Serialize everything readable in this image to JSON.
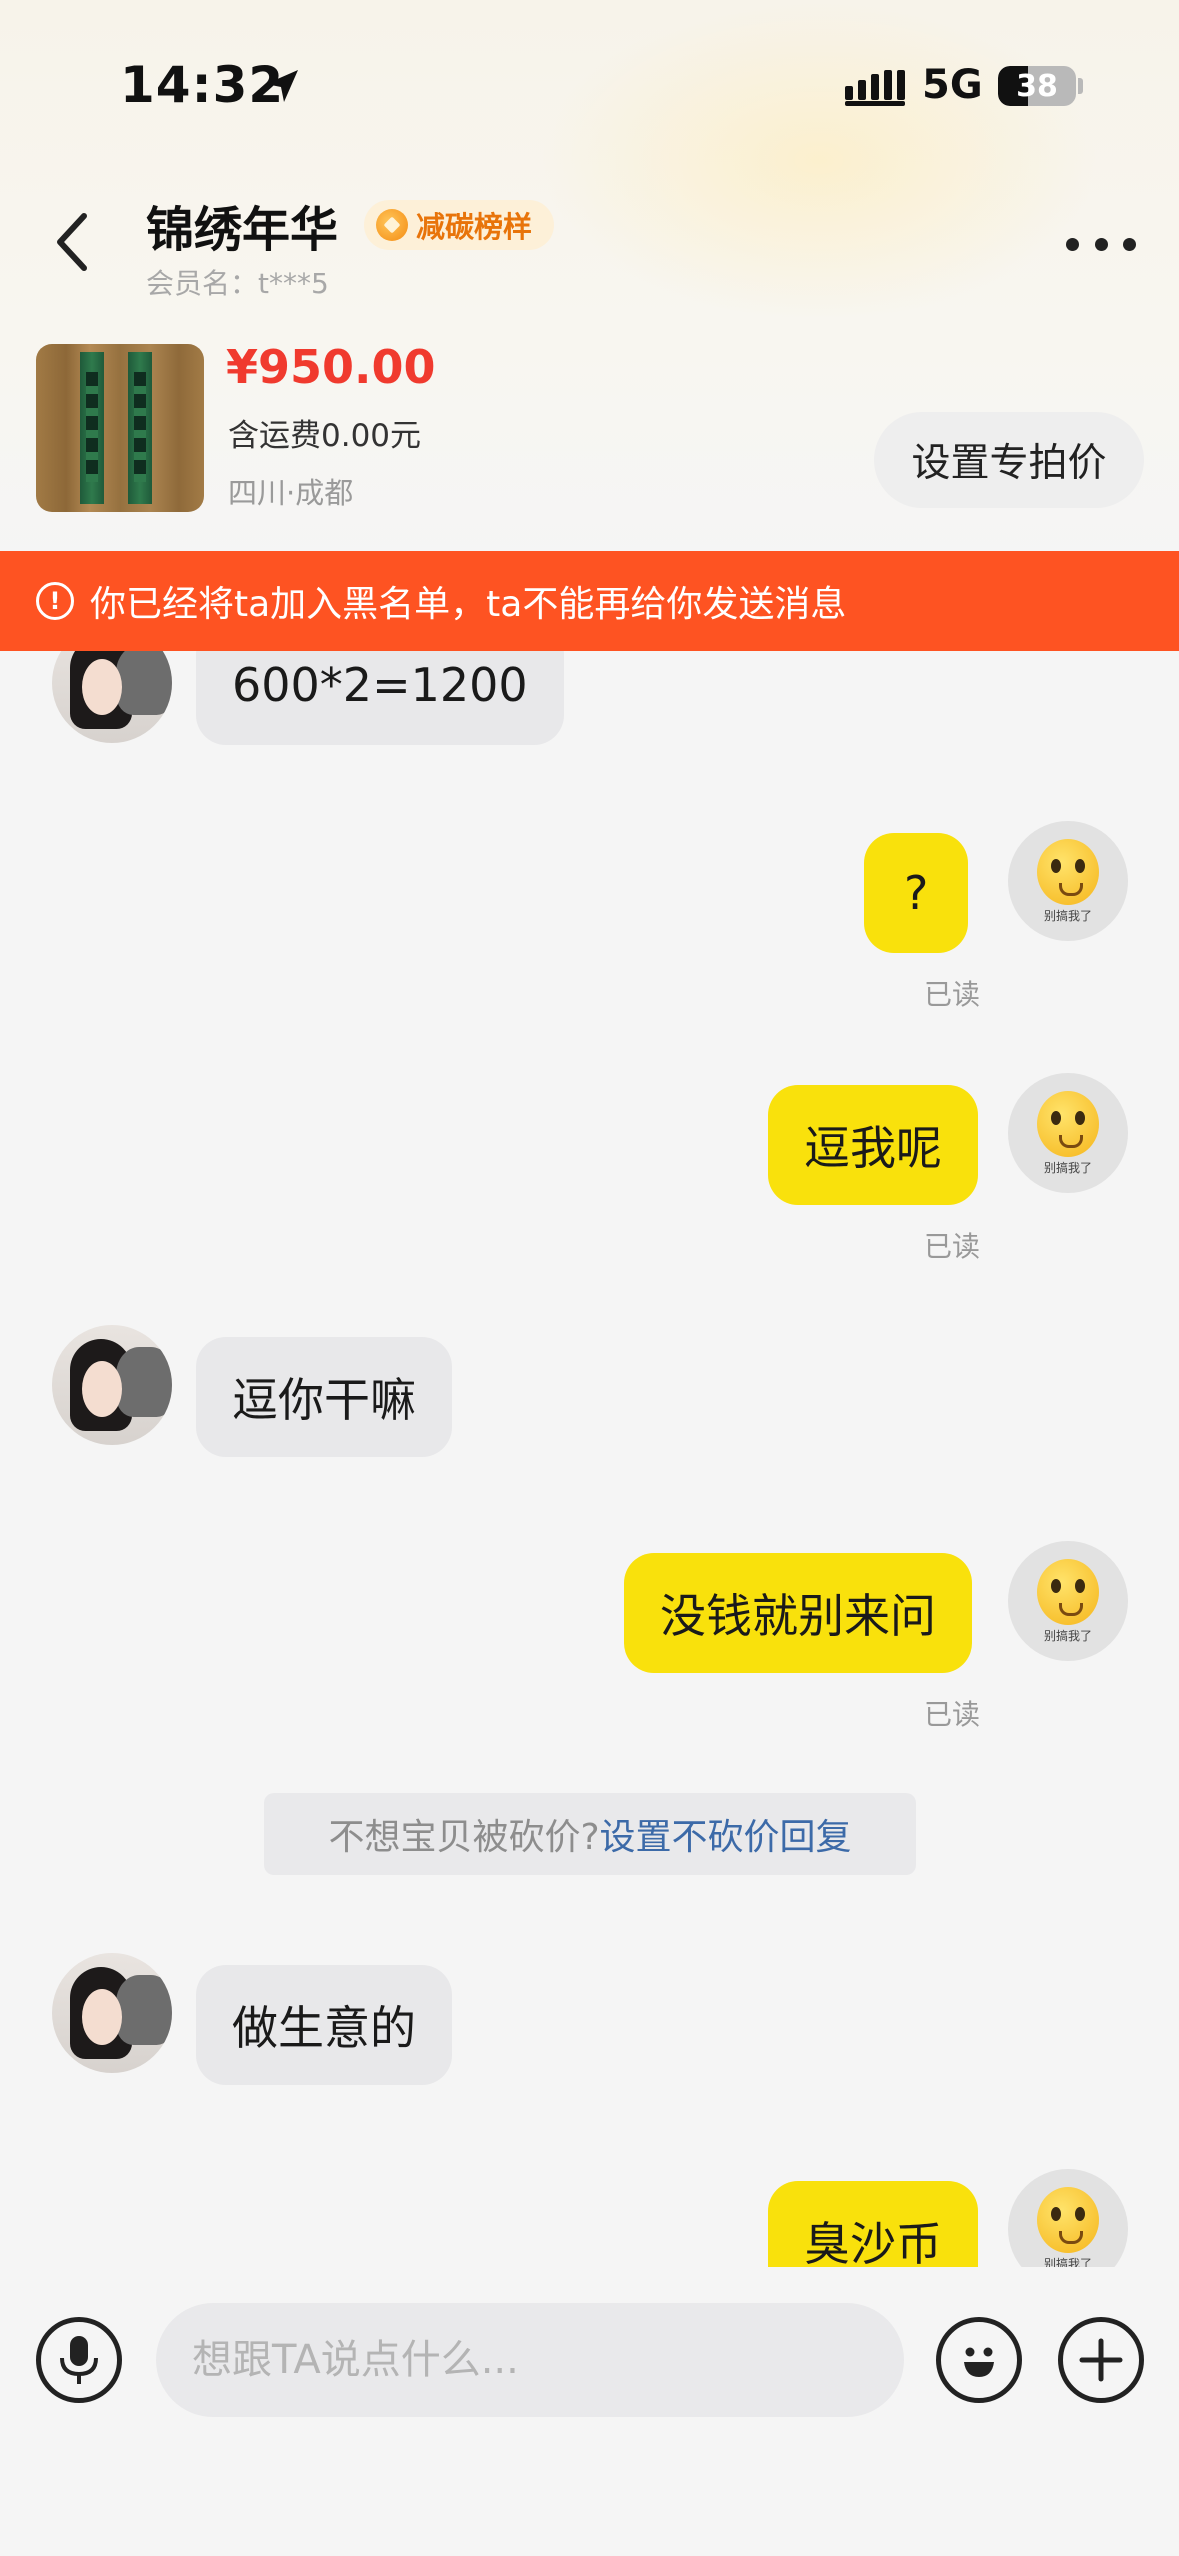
{
  "status_bar": {
    "time": "14:32",
    "network": "5G",
    "battery": "38",
    "battery_level": 0.38
  },
  "header": {
    "seller_name": "锦绣年华",
    "badge": "减碳榜样",
    "member_name": "会员名：t***5"
  },
  "product": {
    "price": "¥950.00",
    "shipping": "含运费0.00元",
    "location": "四川·成都",
    "special_price_button": "设置专拍价"
  },
  "banner": {
    "text": "你已经将ta加入黑名单，ta不能再给你发送消息"
  },
  "messages": [
    {
      "side": "left",
      "text": "600*2=1200"
    },
    {
      "side": "right",
      "text": "?",
      "read": "已读",
      "avatar_caption": "别搞我了"
    },
    {
      "side": "right",
      "text": "逗我呢",
      "read": "已读",
      "avatar_caption": "别搞我了"
    },
    {
      "side": "left",
      "text": "逗你干嘛"
    },
    {
      "side": "right",
      "text": "没钱就别来问",
      "read": "已读",
      "avatar_caption": "别搞我了"
    },
    {
      "side": "left",
      "text": "做生意的"
    },
    {
      "side": "right",
      "text": "臭沙币",
      "avatar_caption": "别搞我了"
    }
  ],
  "system_notice": {
    "text": "不想宝贝被砍价?",
    "link": "设置不砍价回复"
  },
  "input_bar": {
    "placeholder": "想跟TA说点什么..."
  },
  "colors": {
    "banner": "#fe5322",
    "my_bubble": "#f9e10c",
    "their_bubble": "#e8e8ea",
    "price": "#f03a2e",
    "link": "#3c6aa8"
  }
}
